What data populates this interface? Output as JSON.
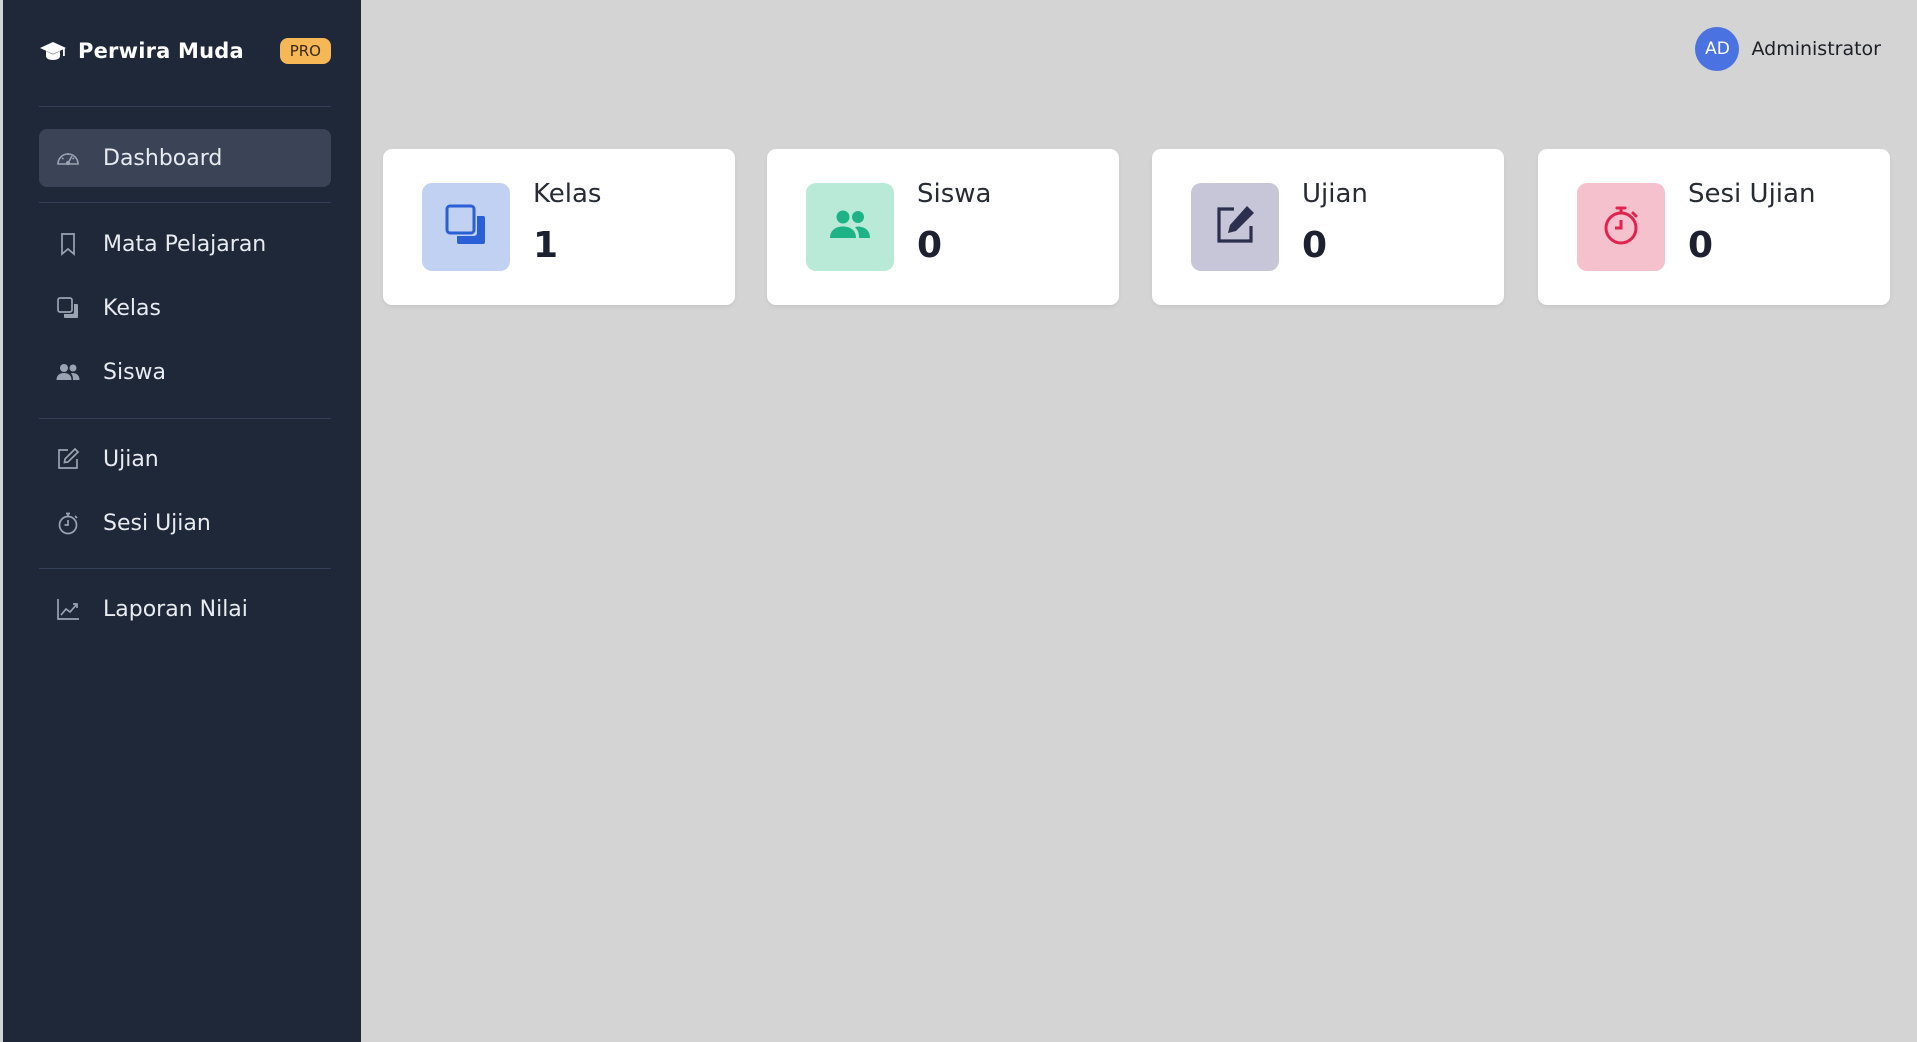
{
  "brand": {
    "name": "Perwira Muda",
    "badge": "PRO",
    "logo_icon": "graduation-cap-icon"
  },
  "sidebar": {
    "items": [
      {
        "label": "Dashboard",
        "icon": "gauge-icon",
        "active": true
      },
      {
        "label": "Mata Pelajaran",
        "icon": "bookmark-icon"
      },
      {
        "label": "Kelas",
        "icon": "copy-squares-icon"
      },
      {
        "label": "Siswa",
        "icon": "users-icon"
      },
      {
        "label": "Ujian",
        "icon": "edit-icon"
      },
      {
        "label": "Sesi Ujian",
        "icon": "stopwatch-icon"
      },
      {
        "label": "Laporan Nilai",
        "icon": "chart-line-icon"
      }
    ]
  },
  "header": {
    "user": {
      "initials": "AD",
      "name": "Administrator"
    }
  },
  "stats": [
    {
      "title": "Kelas",
      "value": "1",
      "icon": "copy-squares-icon",
      "bg": "#c1d1f2",
      "color": "#2a5fd6"
    },
    {
      "title": "Siswa",
      "value": "0",
      "icon": "users-icon",
      "bg": "#b8ead7",
      "color": "#1eb386"
    },
    {
      "title": "Ujian",
      "value": "0",
      "icon": "edit-icon",
      "bg": "#c7c6d8",
      "color": "#2d2f4e"
    },
    {
      "title": "Sesi Ujian",
      "value": "0",
      "icon": "stopwatch-icon",
      "bg": "#f5c1cd",
      "color": "#e0244f"
    }
  ],
  "colors": {
    "sidebar_bg": "#1f2838",
    "content_bg": "#d4d4d4",
    "active_item_bg": "#3a4456",
    "badge_bg": "#f6b756",
    "avatar_bg": "#4a72e0"
  }
}
